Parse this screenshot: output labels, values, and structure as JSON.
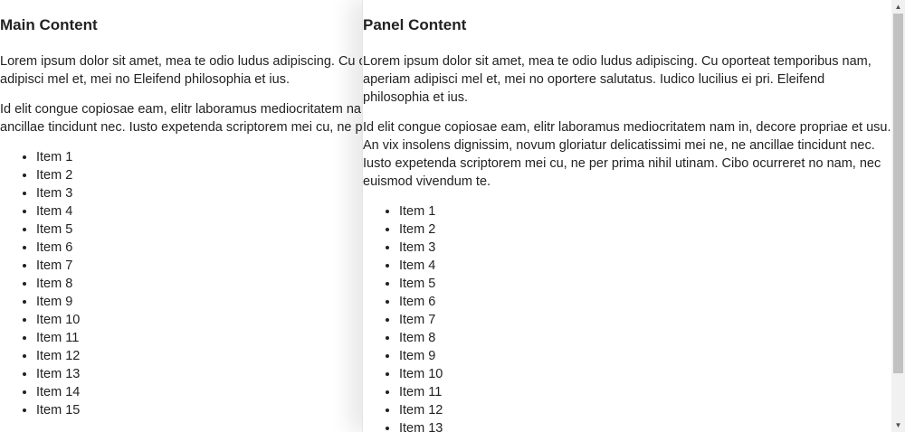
{
  "main": {
    "heading": "Main Content",
    "paragraphs": [
      "Lorem ipsum dolor sit amet, mea te odio ludus adipiscing. Cu oporteat temporibus nam, aperiam adipisci mel et, mei no Eleifend philosophia et ius.",
      "Id elit congue copiosae eam, elitr laboramus mediocritatem nam in, decore propriae et usu. An vix ancillae tincidunt nec. Iusto expetenda scriptorem mei cu, ne per prima nihil utinam."
    ],
    "items": [
      "Item 1",
      "Item 2",
      "Item 3",
      "Item 4",
      "Item 5",
      "Item 6",
      "Item 7",
      "Item 8",
      "Item 9",
      "Item 10",
      "Item 11",
      "Item 12",
      "Item 13",
      "Item 14",
      "Item 15"
    ]
  },
  "panel": {
    "heading": "Panel Content",
    "paragraphs": [
      "Lorem ipsum dolor sit amet, mea te odio ludus adipiscing. Cu oporteat temporibus nam, aperiam adipisci mel et, mei no oportere salutatus. Iudico lucilius ei pri. Eleifend philosophia et ius.",
      "Id elit congue copiosae eam, elitr laboramus mediocritatem nam in, decore propriae et usu. An vix insolens dignissim, novum gloriatur delicatissimi mei ne, ne ancillae tincidunt nec. Iusto expetenda scriptorem mei cu, ne per prima nihil utinam. Cibo ocurreret no nam, nec euismod vivendum te."
    ],
    "items": [
      "Item 1",
      "Item 2",
      "Item 3",
      "Item 4",
      "Item 5",
      "Item 6",
      "Item 7",
      "Item 8",
      "Item 9",
      "Item 10",
      "Item 11",
      "Item 12",
      "Item 13"
    ]
  },
  "scrollbar": {
    "up_icon": "arrow-up-icon",
    "down_icon": "arrow-down-icon"
  }
}
